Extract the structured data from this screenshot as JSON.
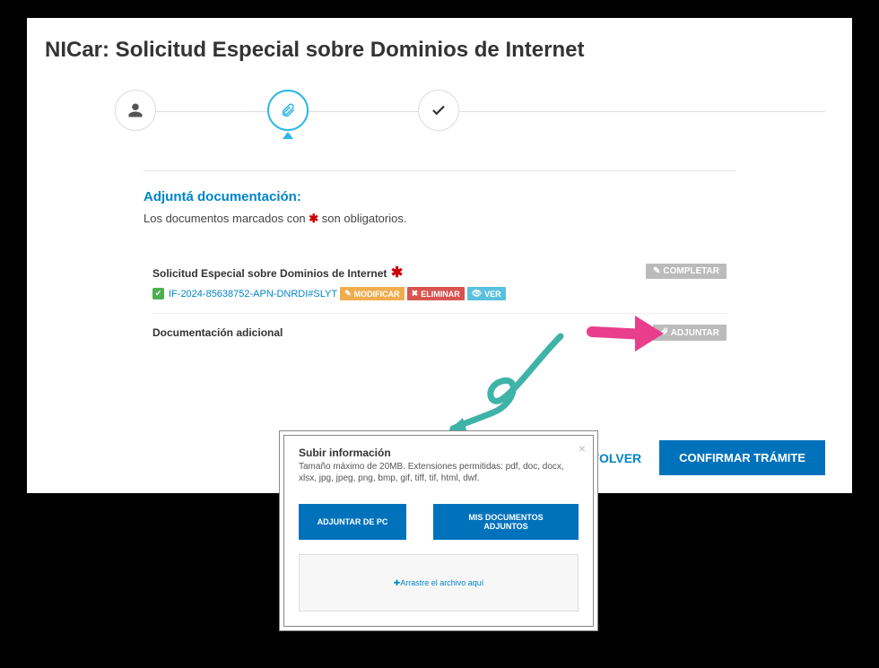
{
  "page": {
    "title": "NICar: Solicitud Especial sobre Dominios de Internet"
  },
  "stepper": {
    "step1_icon": "person-icon",
    "step2_icon": "paperclip-icon",
    "step3_icon": "check-icon"
  },
  "attach": {
    "section_title": "Adjuntá documentación:",
    "hint_prefix": "Los documentos marcados con ",
    "hint_suffix": " son obligatorios.",
    "required_mark": "✱"
  },
  "docs": [
    {
      "label": "Solicitud Especial sobre Dominios de Internet",
      "required": true,
      "file_id": "IF-2024-85638752-APN-DNRDI#SLYT",
      "actions": {
        "modificar": "MODIFICAR",
        "eliminar": "ELIMINAR",
        "ver": "VER"
      },
      "completar_label": "COMPLETAR"
    },
    {
      "label": "Documentación adicional",
      "required": false,
      "adjuntar_label": "ADJUNTAR"
    }
  ],
  "footer": {
    "volver": "VOLVER",
    "confirmar": "CONFIRMAR TRÁMITE"
  },
  "modal": {
    "title": "Subir información",
    "hint": "Tamaño máximo de 20MB. Extensiones permitidas: pdf, doc, docx, xlsx, jpg, jpeg, png, bmp, gif, tiff, tif, html, dwf.",
    "btn_pc": "ADJUNTAR DE PC",
    "btn_mis": "MIS DOCUMENTOS ADJUNTOS",
    "drop_text": "Arrastre el archivo aquí",
    "drop_prefix": "✚ "
  },
  "annotations": {
    "arrow_color": "#e83e8c",
    "swirl_color": "#3fb3a8"
  }
}
